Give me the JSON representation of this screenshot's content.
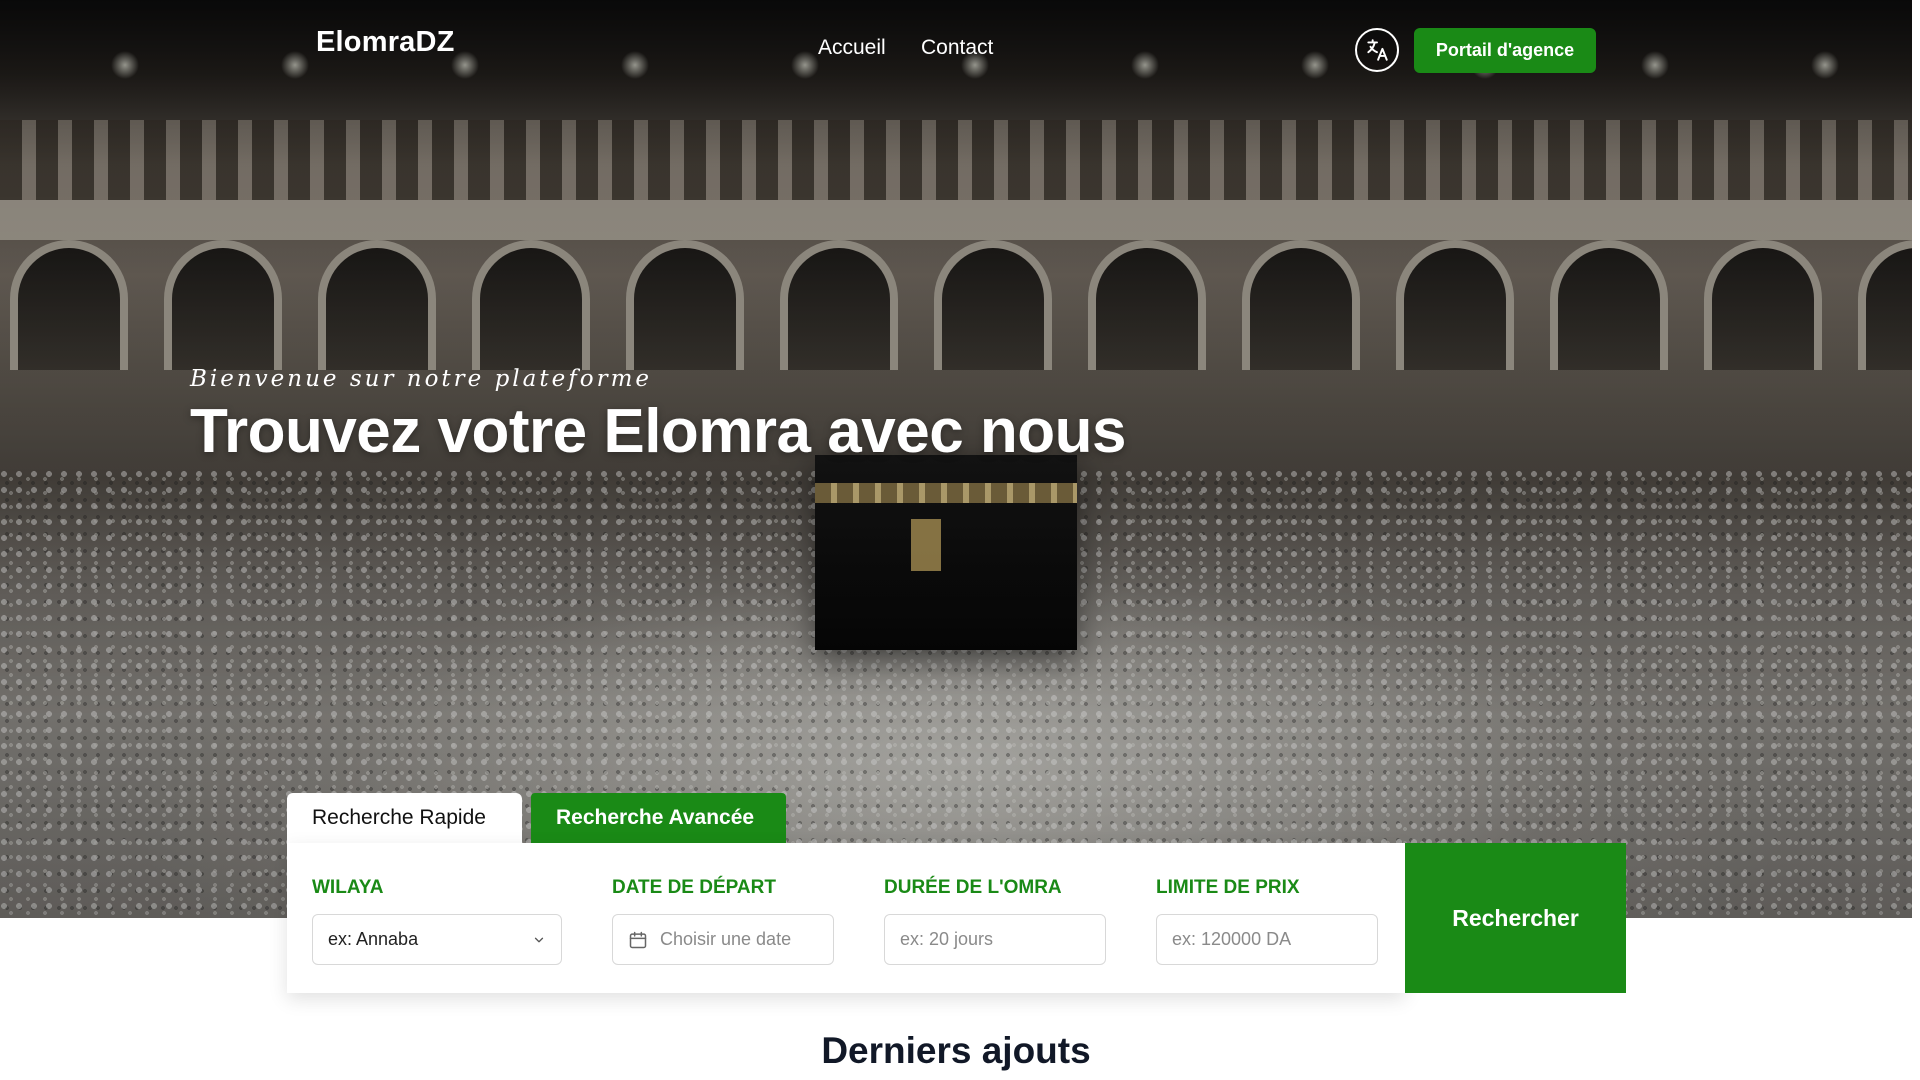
{
  "nav": {
    "brand": "ElomraDZ",
    "links": [
      "Accueil",
      "Contact"
    ],
    "portal_label": "Portail d'agence",
    "language_icon": "translate-icon"
  },
  "hero": {
    "tagline": "Bienvenue sur notre plateforme",
    "title": "Trouvez votre Elomra avec nous"
  },
  "search": {
    "tabs": [
      "Recherche Rapide",
      "Recherche Avancée"
    ],
    "active_tab": "Recherche Rapide",
    "fields": [
      {
        "label": "WILAYA",
        "value": "ex: Annaba",
        "type": "select",
        "icon": "chevron-down-icon"
      },
      {
        "label": "DATE DE DÉPART",
        "placeholder": "Choisir une date",
        "icon": "calendar-icon"
      },
      {
        "label": "DURÉE DE L'OMRA",
        "placeholder": "ex: 20 jours"
      },
      {
        "label": "LIMITE DE PRIX",
        "placeholder": "ex: 120000 DA"
      }
    ],
    "button_label": "Rechercher"
  },
  "sections": {
    "latest_title": "Derniers ajouts"
  },
  "colors": {
    "accent": "#1a8a16",
    "text_dark": "#111827",
    "white": "#ffffff"
  }
}
